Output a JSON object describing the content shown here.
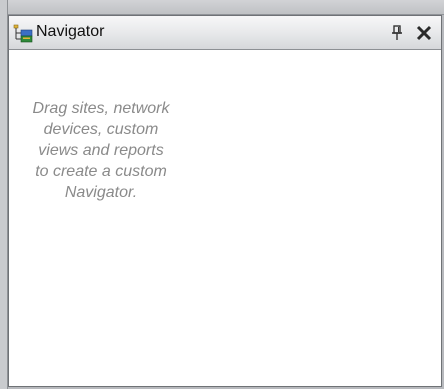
{
  "panel": {
    "title": "Navigator",
    "title_icon": "navigator-tree-icon",
    "pin_icon": "pin-icon",
    "close_icon": "close-icon",
    "empty_hint": "Drag sites, network\ndevices, custom\nviews and reports\nto create a custom\nNavigator."
  },
  "colors": {
    "hint_text": "#8a8a8a",
    "panel_background": "#ffffff",
    "title_bar": "#e8e9eb"
  }
}
